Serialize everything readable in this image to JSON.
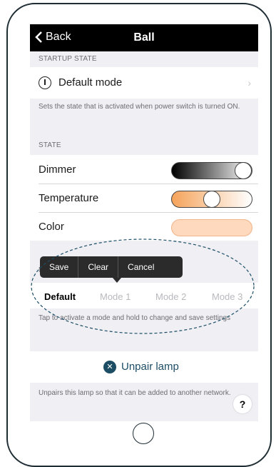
{
  "navbar": {
    "back_label": "Back",
    "title": "Ball"
  },
  "startup": {
    "section_header": "STARTUP STATE",
    "label": "Default mode",
    "footnote": "Sets the state that is activated when power switch is turned ON."
  },
  "state": {
    "section_header": "STATE",
    "rows": [
      {
        "label": "Dimmer",
        "value": 1.0
      },
      {
        "label": "Temperature",
        "value": 0.5
      },
      {
        "label": "Color"
      }
    ]
  },
  "colors": {
    "accent": "#1c4d65",
    "temperature_warm": "#f5a35a",
    "color_swatch": "#ffd9bd"
  },
  "context_menu": {
    "items": [
      "Save",
      "Clear",
      "Cancel"
    ]
  },
  "modes": {
    "section_header_partial": "MO",
    "items": [
      "Default",
      "Mode 1",
      "Mode 2",
      "Mode 3"
    ],
    "selected": "Default",
    "footnote": "Tap to activate a mode and hold to change and save settings"
  },
  "unpair": {
    "label": "Unpair lamp",
    "icon": "close-circle-icon",
    "footnote": "Unpairs this lamp so that it can be added to another network."
  },
  "help": {
    "label": "?"
  }
}
